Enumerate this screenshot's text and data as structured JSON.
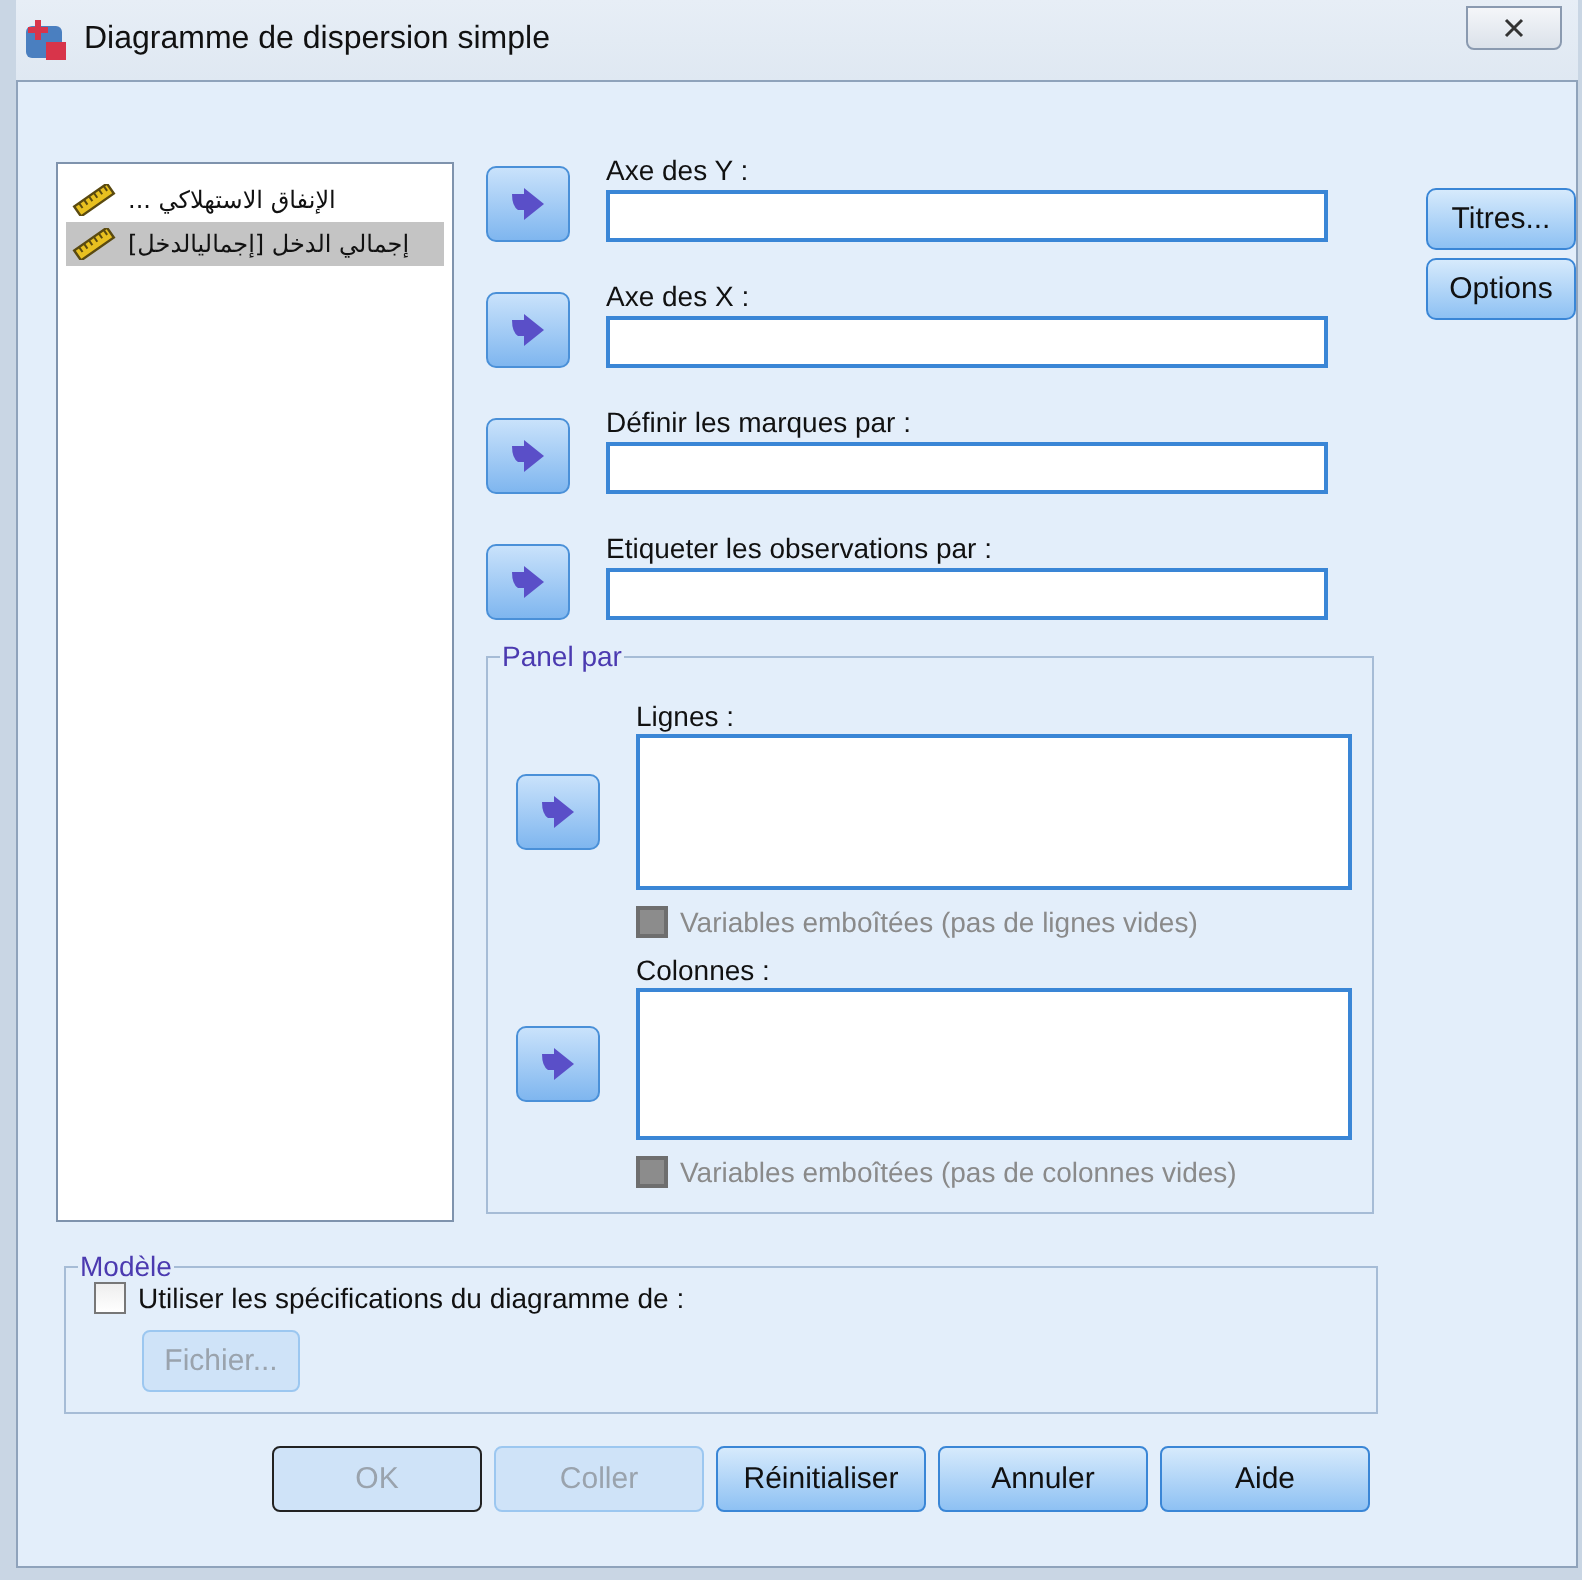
{
  "window": {
    "title": "Diagramme de dispersion simple"
  },
  "variables": [
    {
      "label": "الإنفاق الاستهلاكي ...",
      "selected": false
    },
    {
      "label": "إجمالي الدخل [إجماليالدخل]",
      "selected": true
    }
  ],
  "target_fields": [
    {
      "label": "Axe des Y :"
    },
    {
      "label": "Axe des X :"
    },
    {
      "label": "Définir les marques par :"
    },
    {
      "label": "Etiqueter les observations par :"
    }
  ],
  "side_buttons": [
    {
      "label": "Titres..."
    },
    {
      "label": "Options"
    }
  ],
  "panel": {
    "title": "Panel par",
    "groups": [
      {
        "label": "Lignes :",
        "nested": {
          "label": "Variables emboîtées (pas de lignes vides)",
          "checked": false,
          "disabled": true
        }
      },
      {
        "label": "Colonnes :",
        "nested": {
          "label": "Variables emboîtées (pas de colonnes vides)",
          "checked": false,
          "disabled": true
        }
      }
    ]
  },
  "template": {
    "title": "Modèle",
    "use_spec": {
      "label": "Utiliser les spécifications du diagramme de :",
      "checked": false
    },
    "file_button": {
      "label": "Fichier...",
      "disabled": true
    }
  },
  "buttons": [
    {
      "label": "OK",
      "disabled": true,
      "default": true
    },
    {
      "label": "Coller",
      "disabled": true,
      "default": false
    },
    {
      "label": "Réinitialiser",
      "disabled": false,
      "default": false
    },
    {
      "label": "Annuler",
      "disabled": false,
      "default": false
    },
    {
      "label": "Aide",
      "disabled": false,
      "default": false
    }
  ]
}
